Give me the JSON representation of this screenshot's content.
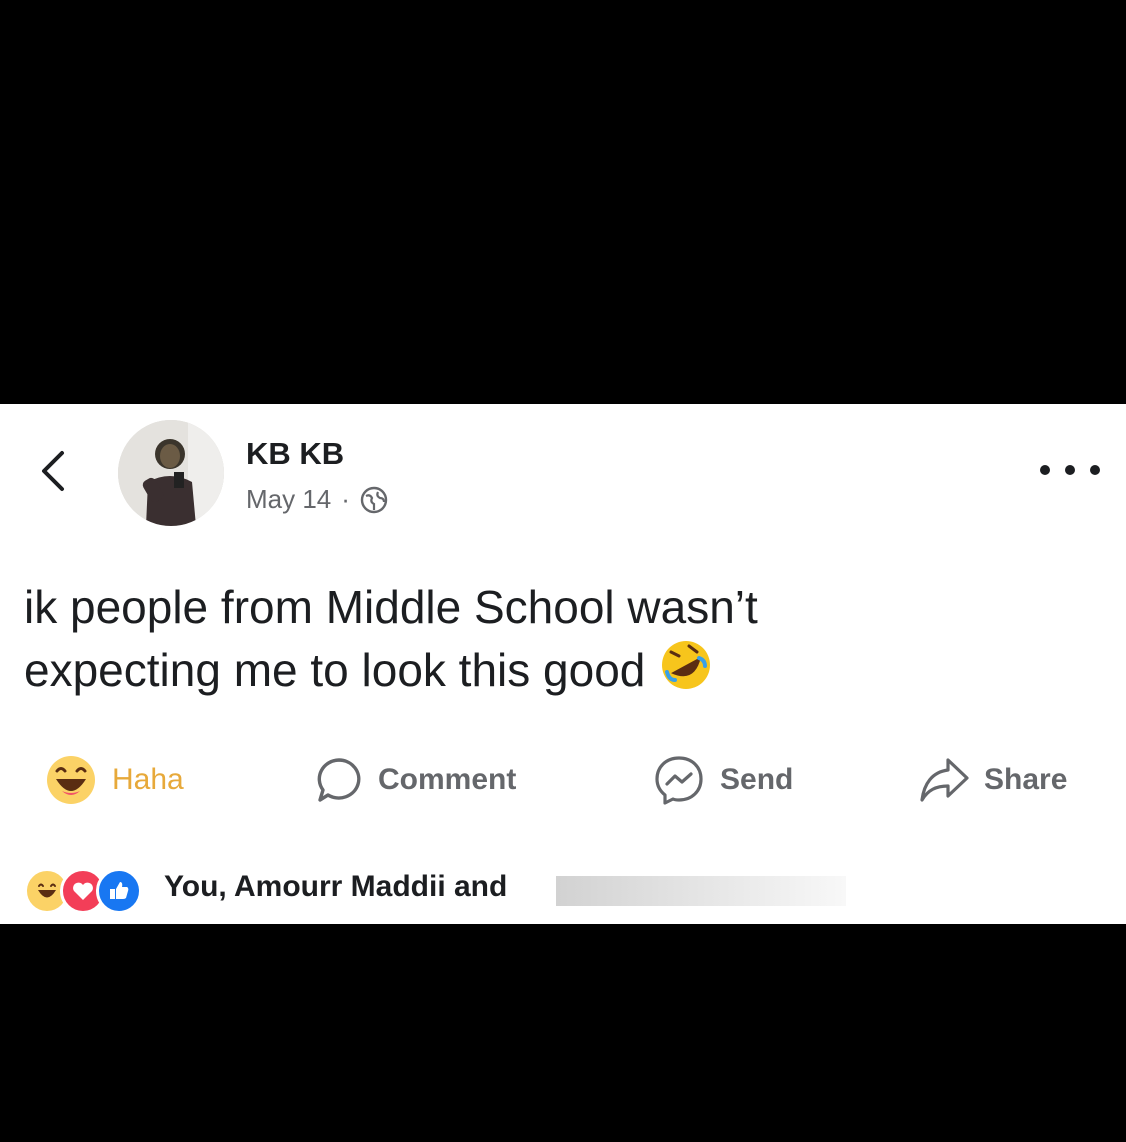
{
  "post": {
    "author": "KB KB",
    "date": "May 14",
    "separator": "·",
    "text_line1": "ik people from Middle School wasn’t",
    "text_line2": "expecting me to look this good",
    "emoji": "rolling-on-floor-laughing-emoji"
  },
  "actions": {
    "reaction_label": "Haha",
    "comment_label": "Comment",
    "send_label": "Send",
    "share_label": "Share"
  },
  "reactions": {
    "summary": "You, Amourr Maddii and "
  },
  "icons": [
    "back-chevron-icon",
    "globe-icon",
    "more-options-icon",
    "haha-icon",
    "comment-icon",
    "messenger-icon",
    "share-icon",
    "love-icon",
    "like-icon"
  ],
  "colors": {
    "background": "#000000",
    "card": "#ffffff",
    "text": "#1c1e21",
    "secondary": "#65676b",
    "haha": "#e7a93a",
    "like": "#1877f2",
    "love": "#f33e58"
  }
}
